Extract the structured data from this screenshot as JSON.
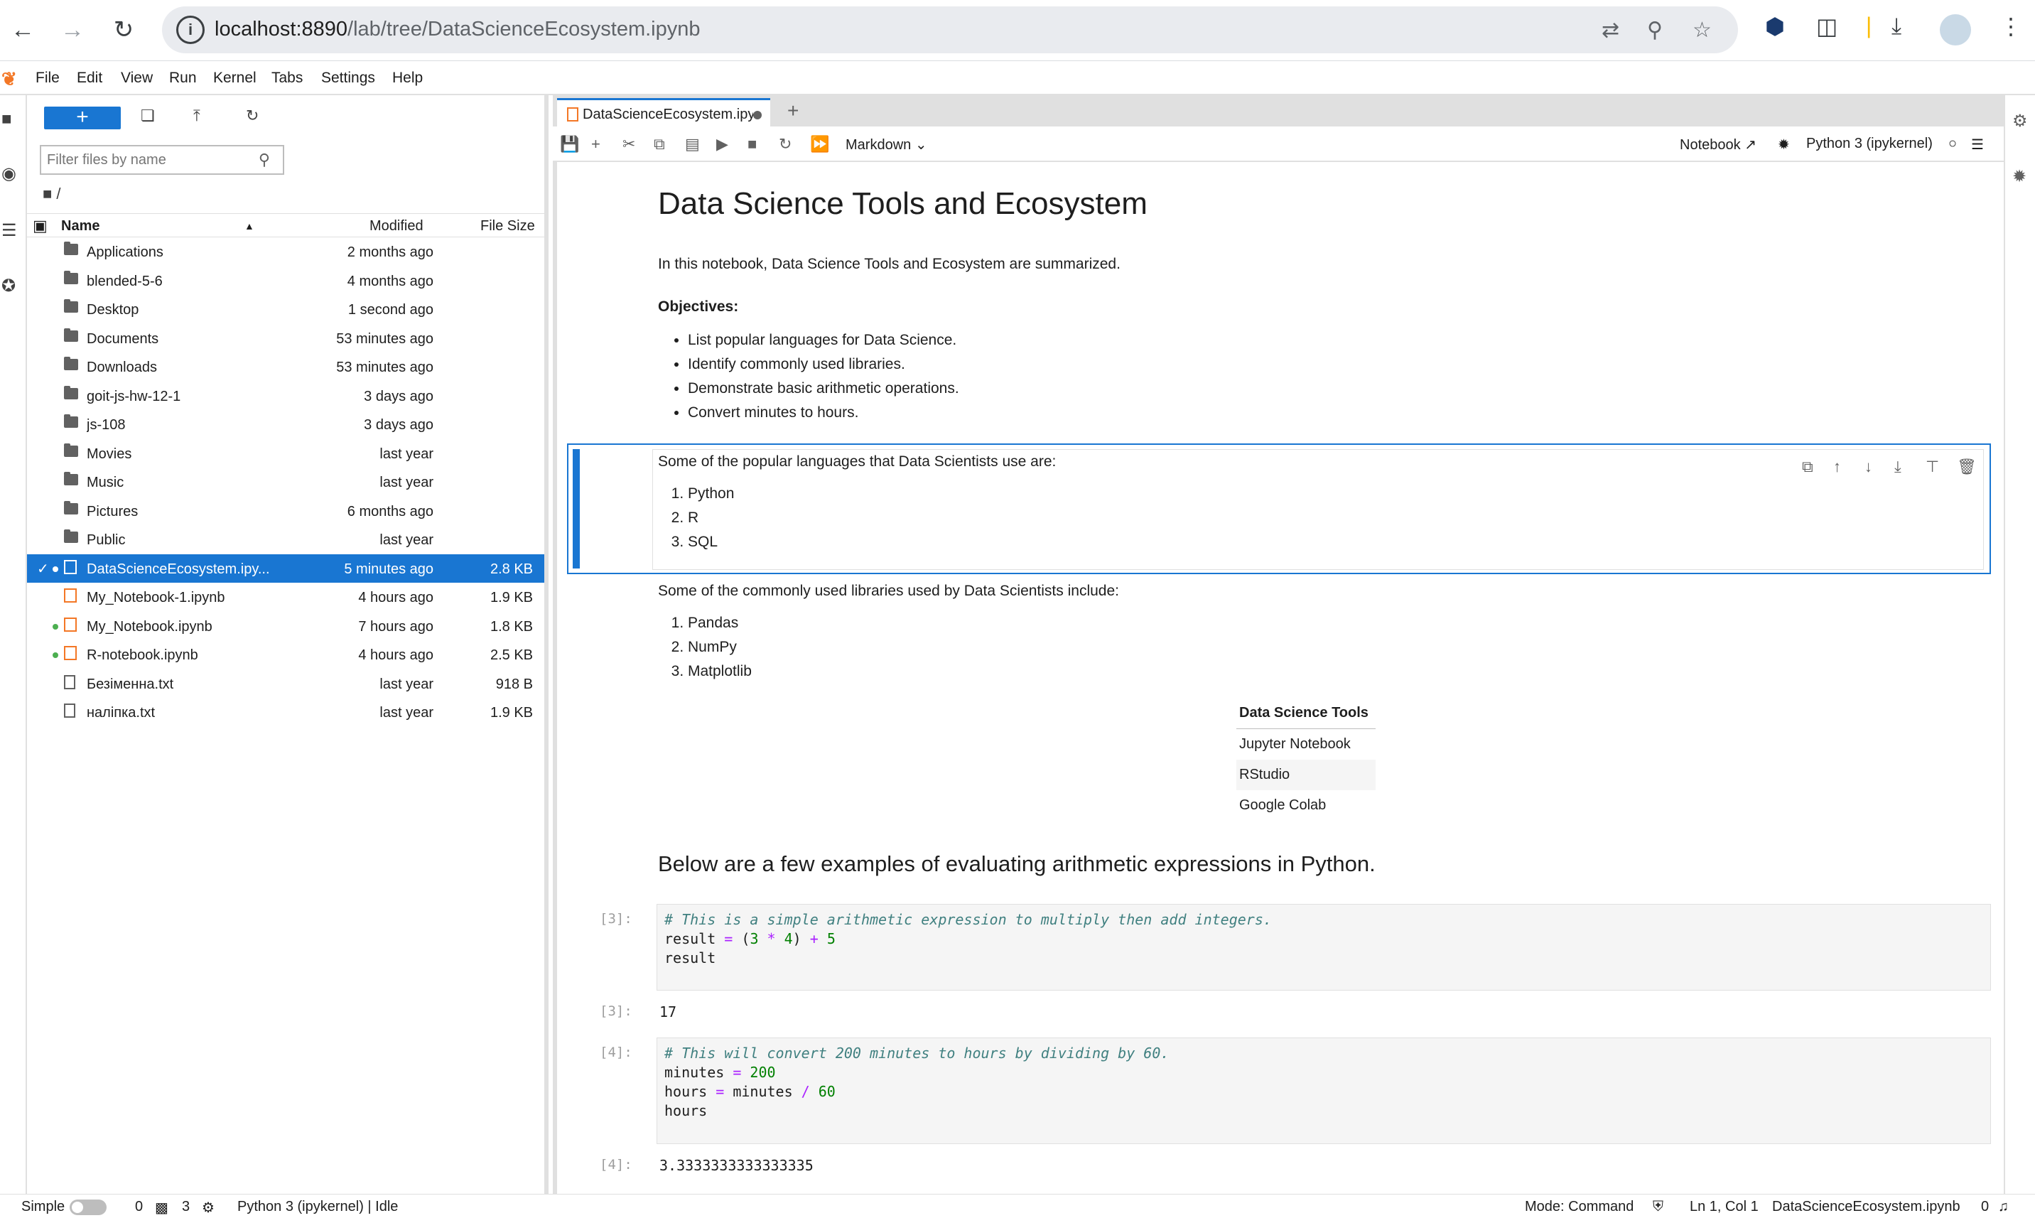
{
  "browser": {
    "back_icon": "arrow-left-icon",
    "url_host": "localhost:8890",
    "url_path": "/lab/tree/DataScienceEcosystem.ipynb"
  },
  "menubar": {
    "items": [
      "File",
      "Edit",
      "View",
      "Run",
      "Kernel",
      "Tabs",
      "Settings",
      "Help"
    ]
  },
  "filebrowser": {
    "new_label": "+",
    "filter_placeholder": "Filter files by name",
    "breadcrumb": "/",
    "col_name": "Name",
    "col_modified": "Modified",
    "col_size": "File Size",
    "files": [
      {
        "name": "Applications",
        "modified": "2 months ago",
        "size": "",
        "type": "folder"
      },
      {
        "name": "blended-5-6",
        "modified": "4 months ago",
        "size": "",
        "type": "folder"
      },
      {
        "name": "Desktop",
        "modified": "1 second ago",
        "size": "",
        "type": "folder"
      },
      {
        "name": "Documents",
        "modified": "53 minutes ago",
        "size": "",
        "type": "folder"
      },
      {
        "name": "Downloads",
        "modified": "53 minutes ago",
        "size": "",
        "type": "folder"
      },
      {
        "name": "goit-js-hw-12-1",
        "modified": "3 days ago",
        "size": "",
        "type": "folder"
      },
      {
        "name": "js-108",
        "modified": "3 days ago",
        "size": "",
        "type": "folder"
      },
      {
        "name": "Movies",
        "modified": "last year",
        "size": "",
        "type": "folder"
      },
      {
        "name": "Music",
        "modified": "last year",
        "size": "",
        "type": "folder"
      },
      {
        "name": "Pictures",
        "modified": "6 months ago",
        "size": "",
        "type": "folder"
      },
      {
        "name": "Public",
        "modified": "last year",
        "size": "",
        "type": "folder"
      },
      {
        "name": "DataScienceEcosystem.ipy...",
        "modified": "5 minutes ago",
        "size": "2.8 KB",
        "type": "notebook"
      },
      {
        "name": "My_Notebook-1.ipynb",
        "modified": "4 hours ago",
        "size": "1.9 KB",
        "type": "notebook"
      },
      {
        "name": "My_Notebook.ipynb",
        "modified": "7 hours ago",
        "size": "1.8 KB",
        "type": "notebook"
      },
      {
        "name": "R-notebook.ipynb",
        "modified": "4 hours ago",
        "size": "2.5 KB",
        "type": "notebook"
      },
      {
        "name": "Безіменна.txt",
        "modified": "last year",
        "size": "918 B",
        "type": "text"
      },
      {
        "name": "наліпка.txt",
        "modified": "last year",
        "size": "1.9 KB",
        "type": "text"
      }
    ]
  },
  "tab": {
    "title": "DataScienceEcosystem.ipynb"
  },
  "nbtoolbar": {
    "cell_type": "Markdown",
    "notebook_label": "Notebook",
    "kernel_label": "Python 3 (ipykernel)"
  },
  "notebook": {
    "title": "Data Science Tools and Ecosystem",
    "intro": "In this notebook, Data Science Tools and Ecosystem are summarized.",
    "objectives_label": "Objectives:",
    "objectives": [
      "List popular languages for Data Science.",
      "Identify commonly used libraries.",
      "Demonstrate basic arithmetic operations.",
      "Convert minutes to hours."
    ],
    "languages_intro": "Some of the popular languages that Data Scientists use are:",
    "languages": [
      "Python",
      "R",
      "SQL"
    ],
    "libraries_intro": "Some of the commonly used libraries used by Data Scientists include:",
    "libraries": [
      "Pandas",
      "NumPy",
      "Matplotlib"
    ],
    "tools_header": "Data Science Tools",
    "tools": [
      "Jupyter Notebook",
      "RStudio",
      "Google Colab"
    ],
    "arith_heading": "Below are a few examples of evaluating arithmetic expressions in Python.",
    "cell3": {
      "prompt_in": "[3]:",
      "comment": "# This is a simple arithmetic expression to multiply then add integers.",
      "line2_a": "result ",
      "line2_eq": "=",
      "line2_b": " (",
      "line2_n1": "3",
      "line2_mul": " * ",
      "line2_n2": "4",
      "line2_c": ") ",
      "line2_plus": "+",
      "line2_n3": " 5",
      "line3": "result",
      "prompt_out": "[3]:",
      "output": "17"
    },
    "cell4": {
      "prompt_in": "[4]:",
      "comment": "# This will convert 200 minutes to hours by dividing by 60.",
      "l2_a": "minutes ",
      "l2_eq": "=",
      "l2_n": " 200",
      "l3_a": "hours ",
      "l3_eq": "=",
      "l3_b": " minutes ",
      "l3_div": "/",
      "l3_n": " 60",
      "l4": "hours",
      "prompt_out": "[4]:",
      "output": "3.3333333333333335"
    }
  },
  "statusbar": {
    "mode_label": "Simple",
    "terminals": "0",
    "kernels": "3",
    "kernel_status": "Python 3 (ipykernel) | Idle",
    "mode": "Mode: Command",
    "position": "Ln 1, Col 1",
    "file": "DataScienceEcosystem.ipynb",
    "notifications": "0"
  }
}
